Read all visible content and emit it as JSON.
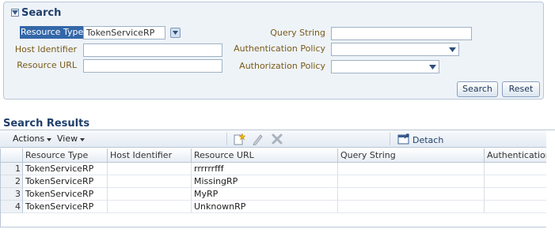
{
  "search": {
    "title": "Search",
    "fields": {
      "resource_type": {
        "label": "Resource Type",
        "value": "TokenServiceRP"
      },
      "host_identifier": {
        "label": "Host Identifier",
        "value": ""
      },
      "resource_url": {
        "label": "Resource URL",
        "value": ""
      },
      "query_string": {
        "label": "Query String",
        "value": ""
      },
      "authentication_policy": {
        "label": "Authentication Policy",
        "value": ""
      },
      "authorization_policy": {
        "label": "Authorization Policy",
        "value": ""
      }
    },
    "buttons": {
      "search": "Search",
      "reset": "Reset"
    }
  },
  "results": {
    "title": "Search Results",
    "toolbar": {
      "actions": "Actions",
      "view": "View",
      "detach": "Detach",
      "icons": [
        "create-icon",
        "edit-icon",
        "delete-icon",
        "detach-icon"
      ]
    },
    "columns": [
      "Resource Type",
      "Host Identifier",
      "Resource URL",
      "Query String",
      "Authentication I"
    ],
    "rows": [
      {
        "num": "1",
        "resource_type": "TokenServiceRP",
        "host_identifier": "",
        "resource_url": "rrrrrrfff",
        "query_string": "",
        "authentication": ""
      },
      {
        "num": "2",
        "resource_type": "TokenServiceRP",
        "host_identifier": "",
        "resource_url": "MissingRP",
        "query_string": "",
        "authentication": ""
      },
      {
        "num": "3",
        "resource_type": "TokenServiceRP",
        "host_identifier": "",
        "resource_url": "MyRP",
        "query_string": "",
        "authentication": ""
      },
      {
        "num": "4",
        "resource_type": "TokenServiceRP",
        "host_identifier": "",
        "resource_url": "UnknownRP",
        "query_string": "",
        "authentication": ""
      }
    ]
  },
  "colors": {
    "accent": "#3367a8",
    "label": "#7a5a18",
    "panel": "#eef3f8",
    "border": "#b9c7d6"
  }
}
